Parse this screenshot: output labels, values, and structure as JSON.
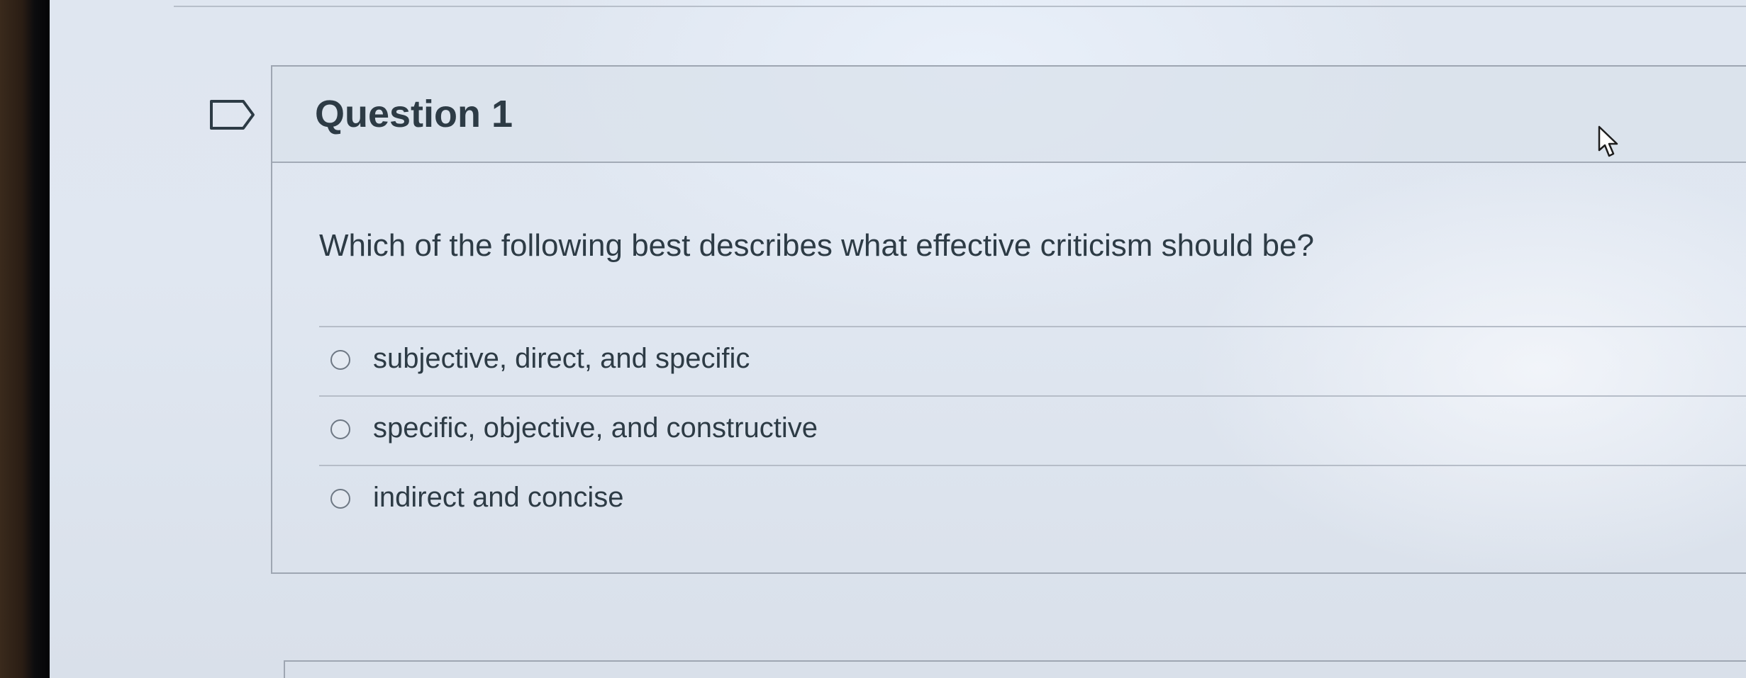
{
  "question": {
    "title": "Question 1",
    "prompt": "Which of the following best describes what effective criticism should be?",
    "answers": [
      {
        "label": "subjective, direct, and specific",
        "selected": false
      },
      {
        "label": "specific, objective, and constructive",
        "selected": false
      },
      {
        "label": "indirect and concise",
        "selected": false
      }
    ]
  },
  "icons": {
    "bookmark": "bookmark-flag-icon",
    "cursor": "mouse-pointer-icon",
    "radio": "radio-circle-icon"
  },
  "colors": {
    "text": "#2d3b45",
    "border": "#9ea6b2",
    "screen_bg": "#dfe6f0"
  }
}
